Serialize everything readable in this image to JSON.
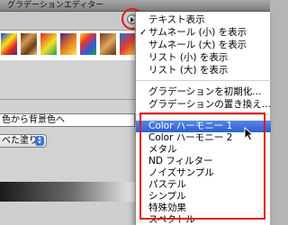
{
  "window": {
    "title": "グラデーションエディター"
  },
  "dialog": {
    "name_field_value": "色から背景色へ",
    "smoothness_select_value": "べた塗り"
  },
  "menu": {
    "view_items": [
      {
        "label": "テキスト表示",
        "checked": false
      },
      {
        "label": "サムネール (小) を表示",
        "checked": true
      },
      {
        "label": "サムネール (大) を表示",
        "checked": false
      },
      {
        "label": "リスト (小) を表示",
        "checked": false
      },
      {
        "label": "リスト (大) を表示",
        "checked": false
      }
    ],
    "action_items": [
      {
        "label": "グラデーションを初期化..."
      },
      {
        "label": "グラデーションの置き換え..."
      }
    ],
    "library_items": [
      {
        "label": "Color ハーモニー 1",
        "highlighted": true
      },
      {
        "label": "Color ハーモニー 2"
      },
      {
        "label": "メタル"
      },
      {
        "label": "ND フィルター"
      },
      {
        "label": "ノイズサンプル"
      },
      {
        "label": "パステル"
      },
      {
        "label": "シンプル"
      },
      {
        "label": "特殊効果"
      },
      {
        "label": "スペクトル"
      }
    ]
  },
  "colors": {
    "highlight": "#2b60d1",
    "annotation_red": "#e01818",
    "menu_bg": "#ffffff",
    "dialog_bg": "#d2d2d2"
  },
  "icons": {
    "flyout": "flyout-menu-icon",
    "check": "checkmark-icon",
    "cursor": "mouse-pointer-icon"
  }
}
